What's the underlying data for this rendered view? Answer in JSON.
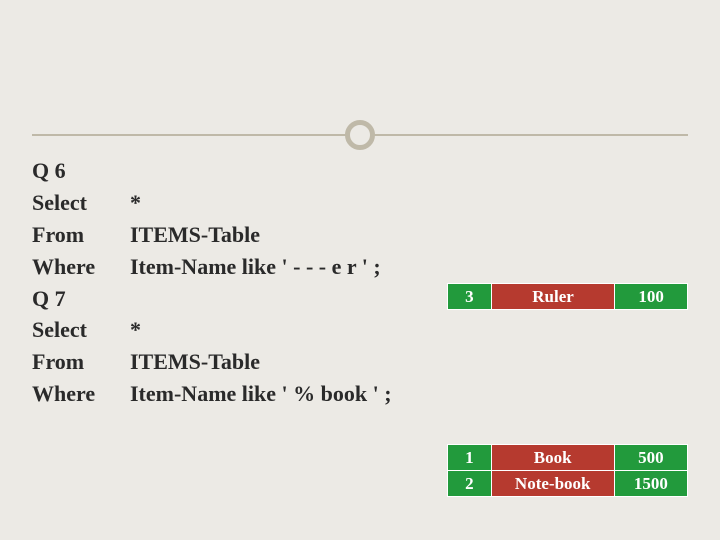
{
  "q6": {
    "label": "Q 6",
    "select_kw": "Select",
    "select_arg": "*",
    "from_kw": "From",
    "from_arg": "ITEMS-Table",
    "where_kw": "Where",
    "where_arg": "Item-Name   like ' - - - e r ' ;"
  },
  "q7": {
    "label": "Q 7",
    "select_kw": "Select",
    "select_arg": "*",
    "from_kw": "From",
    "from_arg": "ITEMS-Table",
    "where_kw": "Where",
    "where_arg": "Item-Name   like ' % book ' ;"
  },
  "result1": {
    "rows": [
      {
        "id": "3",
        "name": "Ruler",
        "price": "100"
      }
    ]
  },
  "result2": {
    "rows": [
      {
        "id": "1",
        "name": "Book",
        "price": "500"
      },
      {
        "id": "2",
        "name": "Note-book",
        "price": "1500"
      }
    ]
  }
}
